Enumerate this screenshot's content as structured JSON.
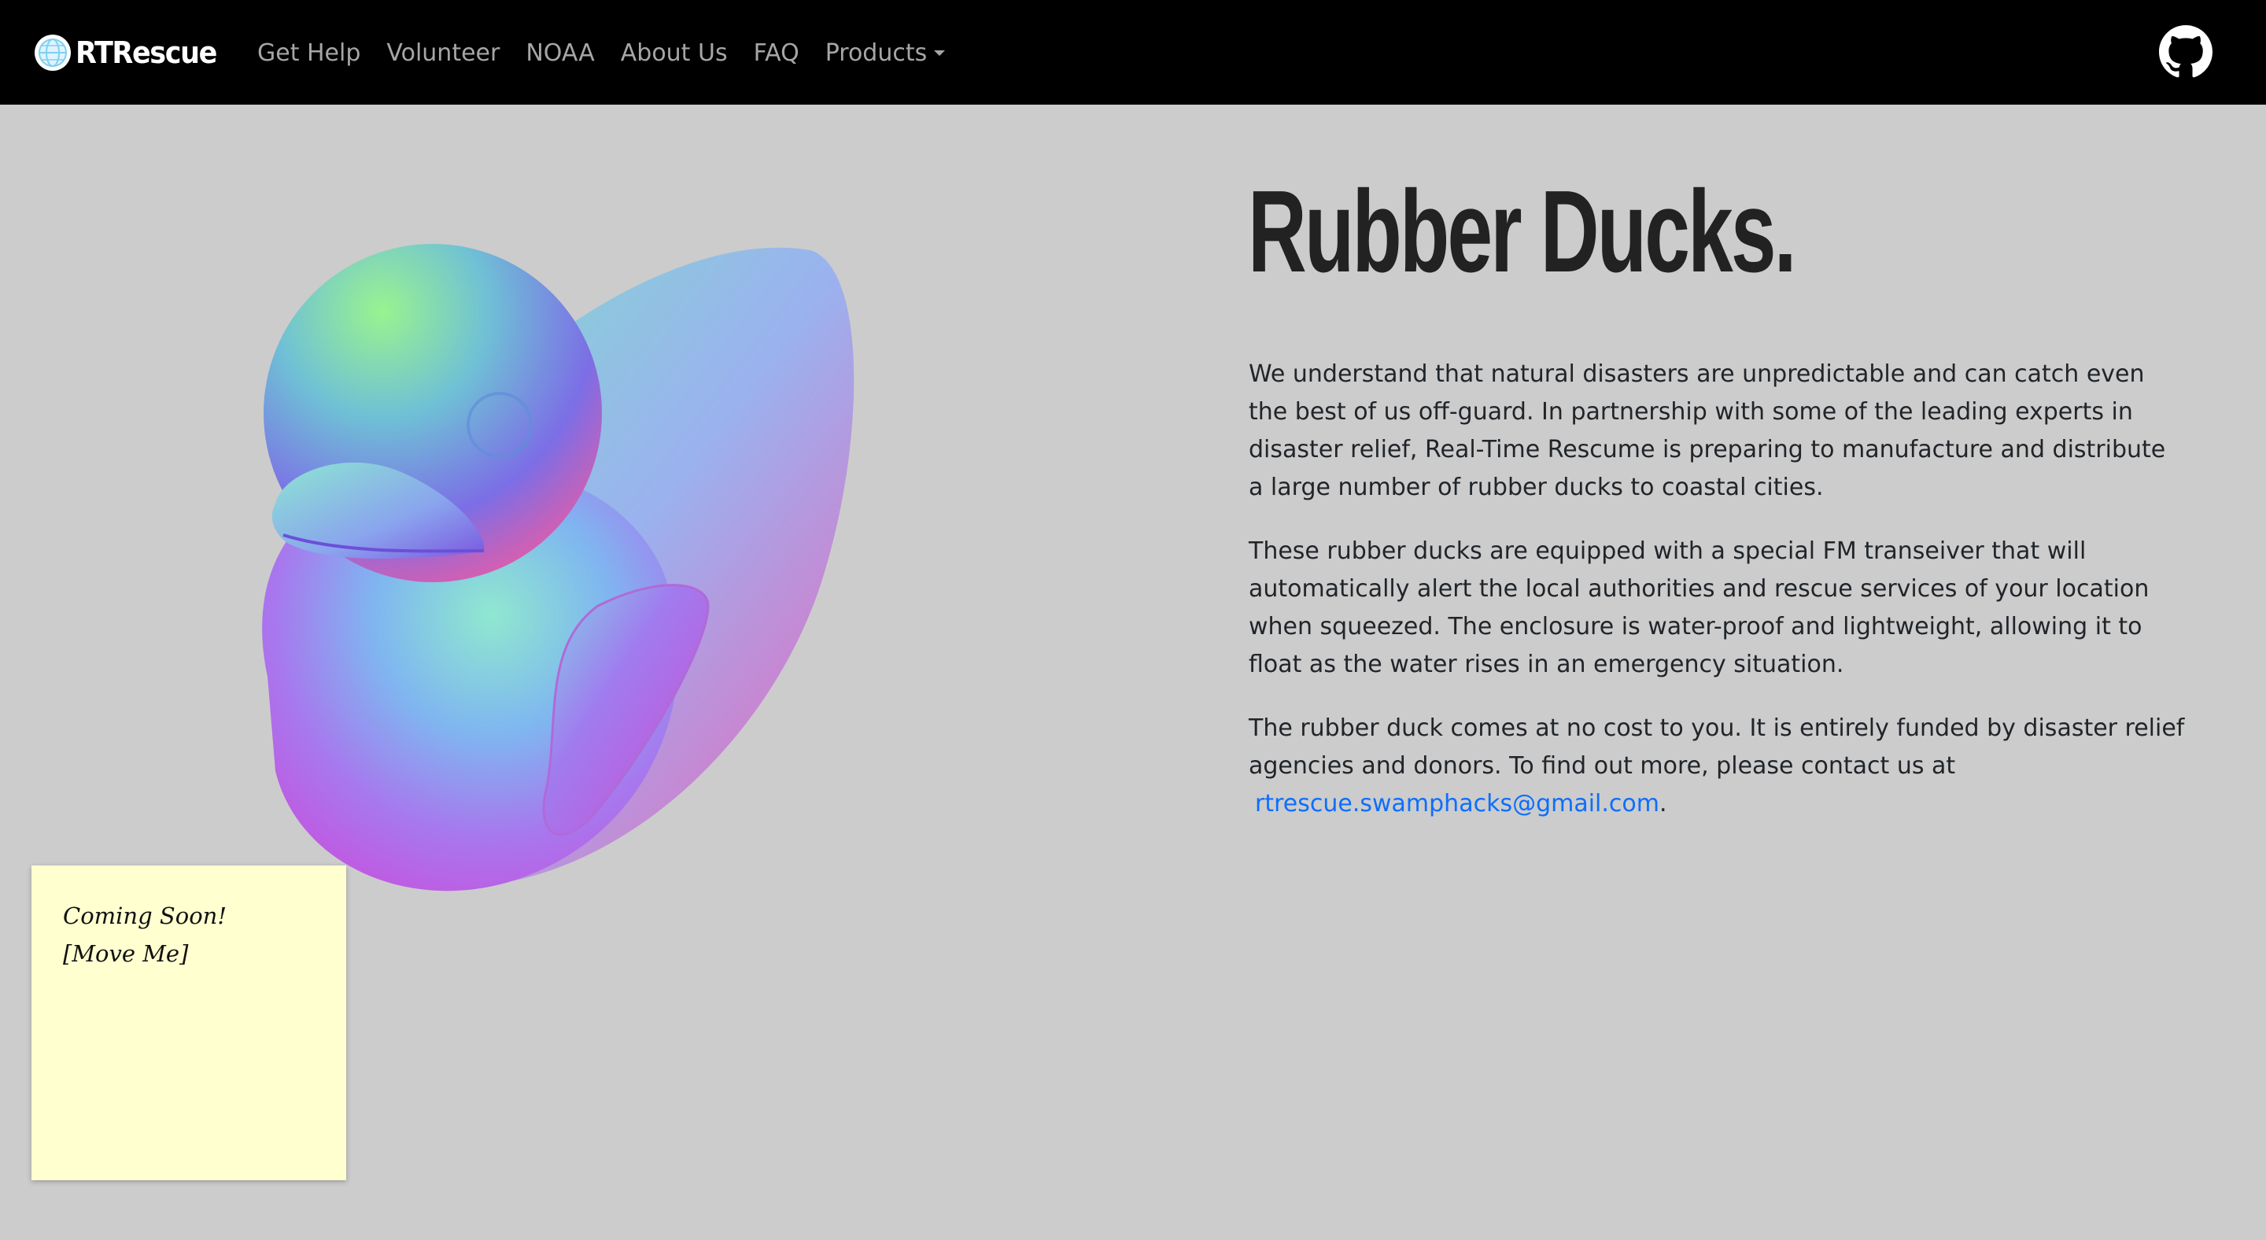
{
  "brand": {
    "name": "RTRescue",
    "logo_icon": "globe-icon"
  },
  "nav": {
    "links": [
      "Get Help",
      "Volunteer",
      "NOAA",
      "About Us",
      "FAQ"
    ],
    "dropdown_label": "Products"
  },
  "github_icon": "github-icon",
  "hero": {
    "title": "Rubber Ducks.",
    "paragraphs": [
      "We understand that natural disasters are unpredictable and can catch even the best of us off-guard. In partnership with some of the leading experts in disaster relief, Real-Time Rescume is preparing to manufacture and distribute a large number of rubber ducks to coastal cities.",
      "These rubber ducks are equipped with a special FM transeiver that will automatically alert the local authorities and rescue services of your location when squeezed. The enclosure is water-proof and lightweight, allowing it to float as the water rises in an emergency situation.",
      "The rubber duck comes at no cost to you. It is entirely funded by disaster relief agencies and donors. To find out more, please contact us at"
    ],
    "contact_email": "rtrescue.swamphacks@gmail.com",
    "period": "."
  },
  "sticky_note": {
    "line1": "Coming Soon!",
    "line2": "[Move Me]"
  },
  "colors": {
    "navbar": "#000000",
    "background": "#cccccc",
    "link": "#0d6efd",
    "sticky": "#ffffd0"
  }
}
